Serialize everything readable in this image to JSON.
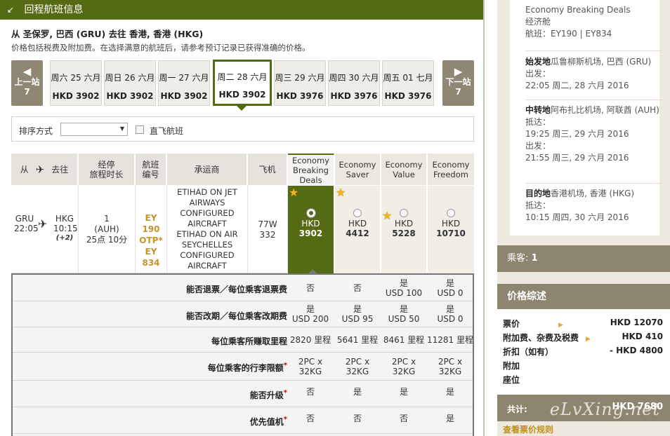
{
  "header": {
    "title": "回程航班信息"
  },
  "route": "从 圣保罗, 巴西 (GRU) 去往 香港, 香港 (HKG)",
  "note": "价格包括税费及附加费。在选择满意的航班后，请参考预订记录已获得准确的价格。",
  "prev": {
    "label": "上一站",
    "count": "7"
  },
  "next": {
    "label": "下一站",
    "count": "7"
  },
  "dates": [
    {
      "day": "周六 25 六月",
      "price": "HKD 3902"
    },
    {
      "day": "周日 26 六月",
      "price": "HKD 3902"
    },
    {
      "day": "周一 27 六月",
      "price": "HKD 3902"
    },
    {
      "day": "周二 28 六月",
      "price": "HKD 3902"
    },
    {
      "day": "周三 29 六月",
      "price": "HKD 3976"
    },
    {
      "day": "周四 30 六月",
      "price": "HKD 3976"
    },
    {
      "day": "周五 01 七月",
      "price": "HKD 3976"
    }
  ],
  "sort": {
    "label": "排序方式",
    "direct": "直飞航班"
  },
  "cols": {
    "from": "从",
    "to": "去往",
    "stops1": "经停",
    "stops2": "旅程时长",
    "flight": "航班编号",
    "carrier": "承运商",
    "aircraft": "飞机"
  },
  "fares": [
    {
      "l1": "Economy",
      "l2": "Breaking",
      "l3": "Deals",
      "cur": "HKD",
      "price": "3902"
    },
    {
      "l1": "Economy",
      "l2": "Saver",
      "l3": "",
      "cur": "HKD",
      "price": "4412"
    },
    {
      "l1": "Economy",
      "l2": "Value",
      "l3": "",
      "cur": "HKD",
      "price": "5228"
    },
    {
      "l1": "Economy",
      "l2": "Freedom",
      "l3": "",
      "cur": "HKD",
      "price": "10710"
    }
  ],
  "flight": {
    "dep_code": "GRU",
    "dep_time": "22:05",
    "arr_code": "HKG",
    "arr_time": "10:15",
    "plus": "(+2)",
    "stops": "1",
    "via": "(AUH)",
    "duration": "25点 10分",
    "no1": "EY 190",
    "otp": "OTP*",
    "no2": "EY 834",
    "carrier1": "ETIHAD ON JET AIRWAYS CONFIGURED AIRCRAFT",
    "carrier2": "ETIHAD ON AIR SEYCHELLES CONFIGURED AIRCRAFT",
    "ac1": "77W",
    "ac2": "332"
  },
  "details": [
    {
      "label": "能否退票／每位乘客退票费",
      "req": false,
      "vals": [
        [
          "否",
          ""
        ],
        [
          "否",
          ""
        ],
        [
          "是",
          "USD 100"
        ],
        [
          "是",
          "USD 0"
        ]
      ]
    },
    {
      "label": "能否改期／每位乘客改期费",
      "req": false,
      "vals": [
        [
          "是",
          "USD 200"
        ],
        [
          "是",
          "USD 95"
        ],
        [
          "是",
          "USD 50"
        ],
        [
          "是",
          "USD 0"
        ]
      ]
    },
    {
      "label": "每位乘客所赚取里程",
      "req": false,
      "vals": [
        [
          "2820 里程",
          ""
        ],
        [
          "5641 里程",
          ""
        ],
        [
          "8461 里程",
          ""
        ],
        [
          "11281 里程",
          ""
        ]
      ]
    },
    {
      "label": "每位乘客的行李限额",
      "req": true,
      "vals": [
        [
          "2PC x",
          "32KG"
        ],
        [
          "2PC x",
          "32KG"
        ],
        [
          "2PC x",
          "32KG"
        ],
        [
          "2PC x",
          "32KG"
        ]
      ]
    },
    {
      "label": "能否升级",
      "req": true,
      "vals": [
        [
          "否",
          ""
        ],
        [
          "是",
          ""
        ],
        [
          "是",
          ""
        ],
        [
          "是",
          ""
        ]
      ]
    },
    {
      "label": "优先值机",
      "req": true,
      "vals": [
        [
          "否",
          ""
        ],
        [
          "否",
          ""
        ],
        [
          "否",
          ""
        ],
        [
          "是",
          ""
        ]
      ]
    }
  ],
  "itinerary": {
    "fare": "Economy Breaking Deals",
    "cabin": "经济舱",
    "flights": "航班：EY190 | EY834",
    "origin_title": "始发地",
    "origin_name": "瓜鲁柳斯机场, 巴西 (GRU)",
    "dep_lbl": "出发：",
    "dep_val": "22:05 周二, 28 六月 2016",
    "transfer_title": "中转地",
    "transfer_name": "阿布扎比机场, 阿联酋 (AUH)",
    "arr_lbl": "抵达：",
    "tr_arr": "19:25 周三, 29 六月 2016",
    "tr_dep_lbl": "出发：",
    "tr_dep": "21:55 周三, 29 六月 2016",
    "dest_title": "目的地",
    "dest_name": "香港机场, 香港 (HKG)",
    "dest_arr_lbl": "抵达：",
    "dest_arr": "10:15 周四, 30 六月 2016"
  },
  "passengers": {
    "label": "乘客:",
    "count": "1"
  },
  "price_summary": {
    "title": "价格综述",
    "fare_lbl": "票价",
    "fare_val": "HKD 12070",
    "tax_lbl": "附加费、杂费及税费",
    "tax_val": "HKD 410",
    "disc_lbl": "折扣（如有）",
    "disc_val": "- HKD 4800",
    "extra_lbl": "附加",
    "seat_lbl": "座位",
    "total_lbl": "共计:",
    "total_val": "HKD 7680",
    "rules": "查看票价规则"
  },
  "watermark": "eLvXing.net"
}
